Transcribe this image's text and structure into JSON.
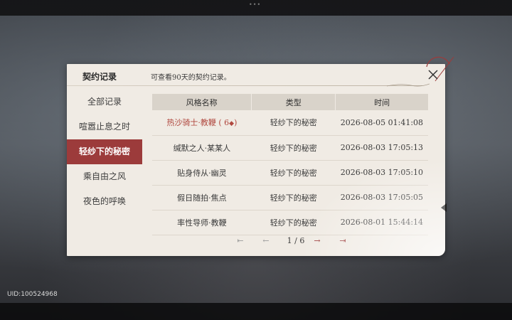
{
  "window": {
    "top_dots": "•••"
  },
  "modal": {
    "title": "契约记录",
    "subtitle": "可查看90天的契约记录。"
  },
  "sidebar": {
    "items": [
      {
        "label": "全部记录",
        "active": false
      },
      {
        "label": "喧嚣止息之时",
        "active": false
      },
      {
        "label": "轻纱下的秘密",
        "active": true
      },
      {
        "label": "乘自由之风",
        "active": false
      },
      {
        "label": "夜色的呼唤",
        "active": false
      }
    ]
  },
  "table": {
    "headers": [
      "风格名称",
      "类型",
      "时间"
    ],
    "rows": [
      {
        "name": "热沙骑士·教鞭 ( 6",
        "rate_icon": "◆",
        "name_suffix": ")",
        "type": "轻纱下的秘密",
        "time": "2026-08-05 01:41:08",
        "highlight": true
      },
      {
        "name": "缄默之人·某某人",
        "type": "轻纱下的秘密",
        "time": "2026-08-03 17:05:13"
      },
      {
        "name": "贴身侍从·幽灵",
        "type": "轻纱下的秘密",
        "time": "2026-08-03 17:05:10"
      },
      {
        "name": "假日随拍·焦点",
        "type": "轻纱下的秘密",
        "time": "2026-08-03 17:05:05"
      },
      {
        "name": "率性导师·教鞭",
        "type": "轻纱下的秘密",
        "time": "2026-08-01 15:44:14"
      }
    ]
  },
  "pager": {
    "current_page": 1,
    "total_pages": 6,
    "text": "1 / 6",
    "first_icon": "⇤",
    "prev_icon": "←",
    "next_icon": "→",
    "last_icon": "⇥"
  },
  "footer": {
    "uid": "UID:100524968"
  },
  "colors": {
    "accent": "#9c3b3b",
    "highlight_text": "#b0473e",
    "panel": "#f0ebe4",
    "header_row": "#d9d3ca"
  }
}
